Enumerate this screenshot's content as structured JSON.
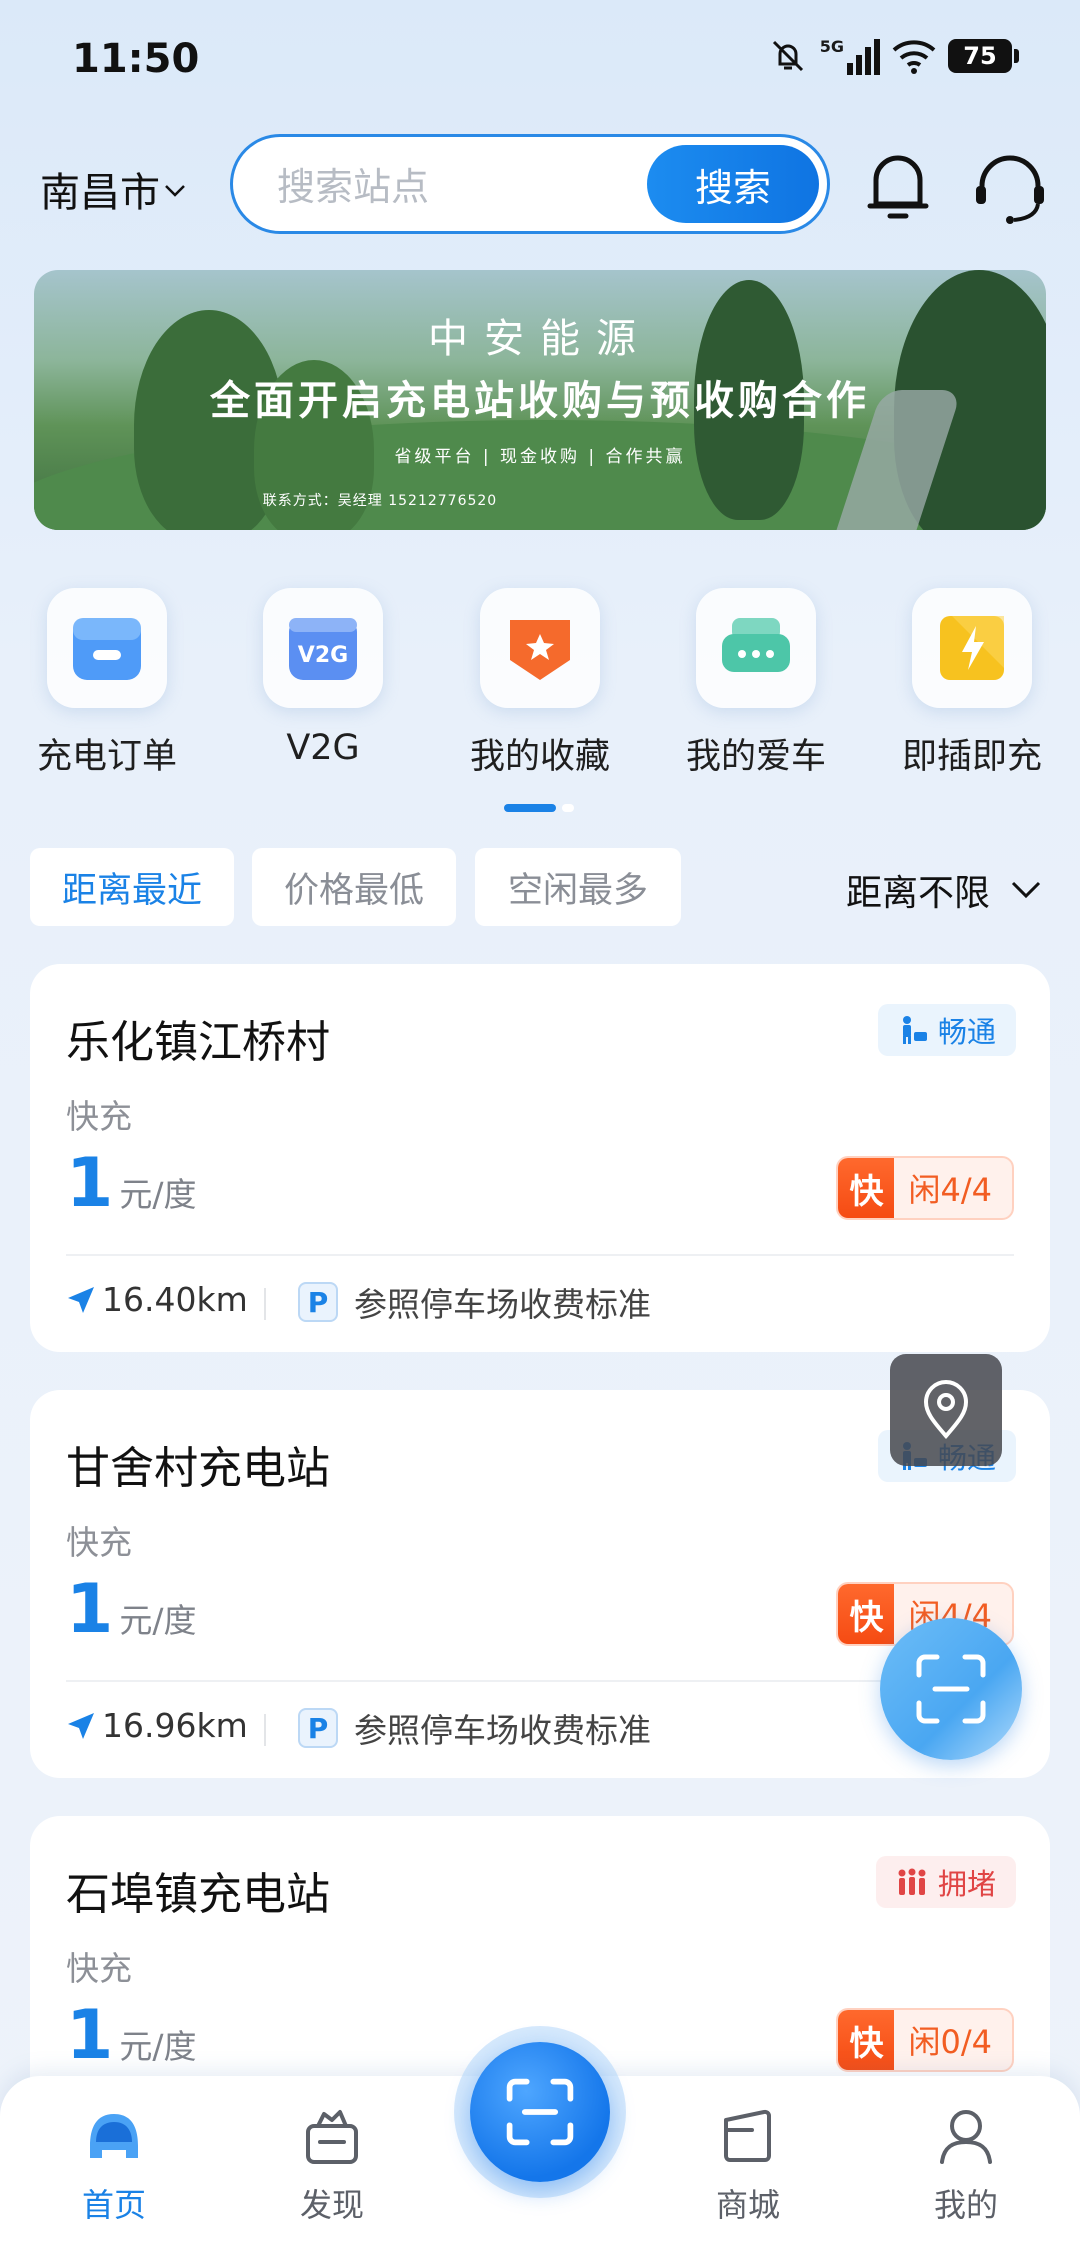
{
  "status_bar": {
    "time": "11:50",
    "network": "5G",
    "battery": "75"
  },
  "header": {
    "city": "南昌市",
    "search_placeholder": "搜索站点",
    "search_button": "搜索"
  },
  "banner": {
    "line1": "中安能源",
    "line2": "全面开启充电站收购与预收购合作",
    "line3": "省级平台 | 现金收购 | 合作共赢",
    "line4": "联系方式：吴经理 15212776520"
  },
  "quick_menu": [
    {
      "label": "充电订单",
      "icon": "order-icon"
    },
    {
      "label": "V2G",
      "icon": "v2g-icon"
    },
    {
      "label": "我的收藏",
      "icon": "favorite-icon"
    },
    {
      "label": "我的爱车",
      "icon": "car-icon"
    },
    {
      "label": "即插即充",
      "icon": "plug-charge-icon"
    }
  ],
  "filters": {
    "tabs": [
      "距离最近",
      "价格最低",
      "空闲最多"
    ],
    "active_tab": "距离最近",
    "distance": "距离不限"
  },
  "stations": [
    {
      "name": "乐化镇江桥村",
      "type": "快充",
      "price": "1",
      "unit": "元/度",
      "traffic": "畅通",
      "traffic_state": "smooth",
      "fast_label": "快",
      "free": "闲4/4",
      "distance": "16.40km",
      "parking": "参照停车场收费标准"
    },
    {
      "name": "甘舍村充电站",
      "type": "快充",
      "price": "1",
      "unit": "元/度",
      "traffic": "畅通",
      "traffic_state": "smooth",
      "fast_label": "快",
      "free": "闲4/4",
      "distance": "16.96km",
      "parking": "参照停车场收费标准"
    },
    {
      "name": "石埠镇充电站",
      "type": "快充",
      "price": "1",
      "unit": "元/度",
      "traffic": "拥堵",
      "traffic_state": "busy",
      "fast_label": "快",
      "free": "闲0/4"
    }
  ],
  "bottom_nav": [
    {
      "label": "首页",
      "icon": "home-car-icon",
      "active": true
    },
    {
      "label": "发现",
      "icon": "discover-icon",
      "active": false
    },
    {
      "label": "",
      "icon": "scan-icon",
      "active": false
    },
    {
      "label": "商城",
      "icon": "shop-icon",
      "active": false
    },
    {
      "label": "我的",
      "icon": "profile-icon",
      "active": false
    }
  ],
  "colors": {
    "primary": "#1a82e6",
    "fast": "#f54a12",
    "busy": "#e04545"
  }
}
